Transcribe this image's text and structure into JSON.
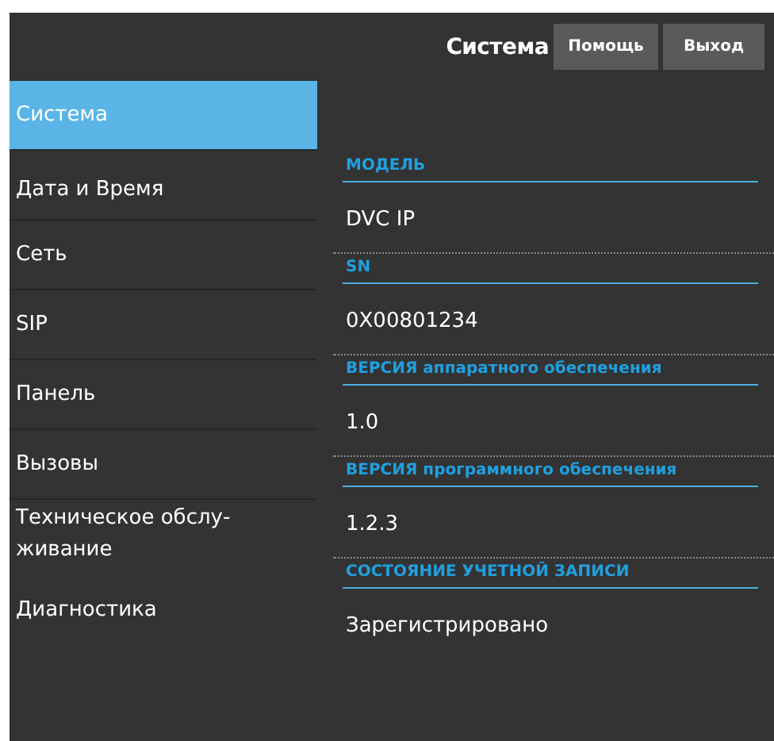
{
  "header": {
    "title": "Система",
    "buttons": [
      "Помощь",
      "Выход"
    ]
  },
  "sidebar": {
    "items": [
      {
        "label": "Система",
        "selected": true
      },
      {
        "label": "Дата и Время",
        "selected": false
      },
      {
        "label": "Сеть",
        "selected": false
      },
      {
        "label": "SIP",
        "selected": false
      },
      {
        "label": "Панель",
        "selected": false
      },
      {
        "label": "Вызовы",
        "selected": false
      },
      {
        "label": "Техническое обслу-живание",
        "selected": false
      },
      {
        "label": "Диагностика",
        "selected": false
      }
    ]
  },
  "fields": [
    {
      "label": "МОДЕЛЬ",
      "value": "DVC IP"
    },
    {
      "label": "SN",
      "value": "0X00801234"
    },
    {
      "label": "ВЕРСИЯ аппаратного обеспечения",
      "value": "1.0"
    },
    {
      "label": "ВЕРСИЯ программного обеспечения",
      "value": "1.2.3"
    },
    {
      "label": "СОСТОЯНИЕ УЧЕТНОЙ ЗАПИСИ",
      "value": "Зарегистрировано"
    }
  ]
}
